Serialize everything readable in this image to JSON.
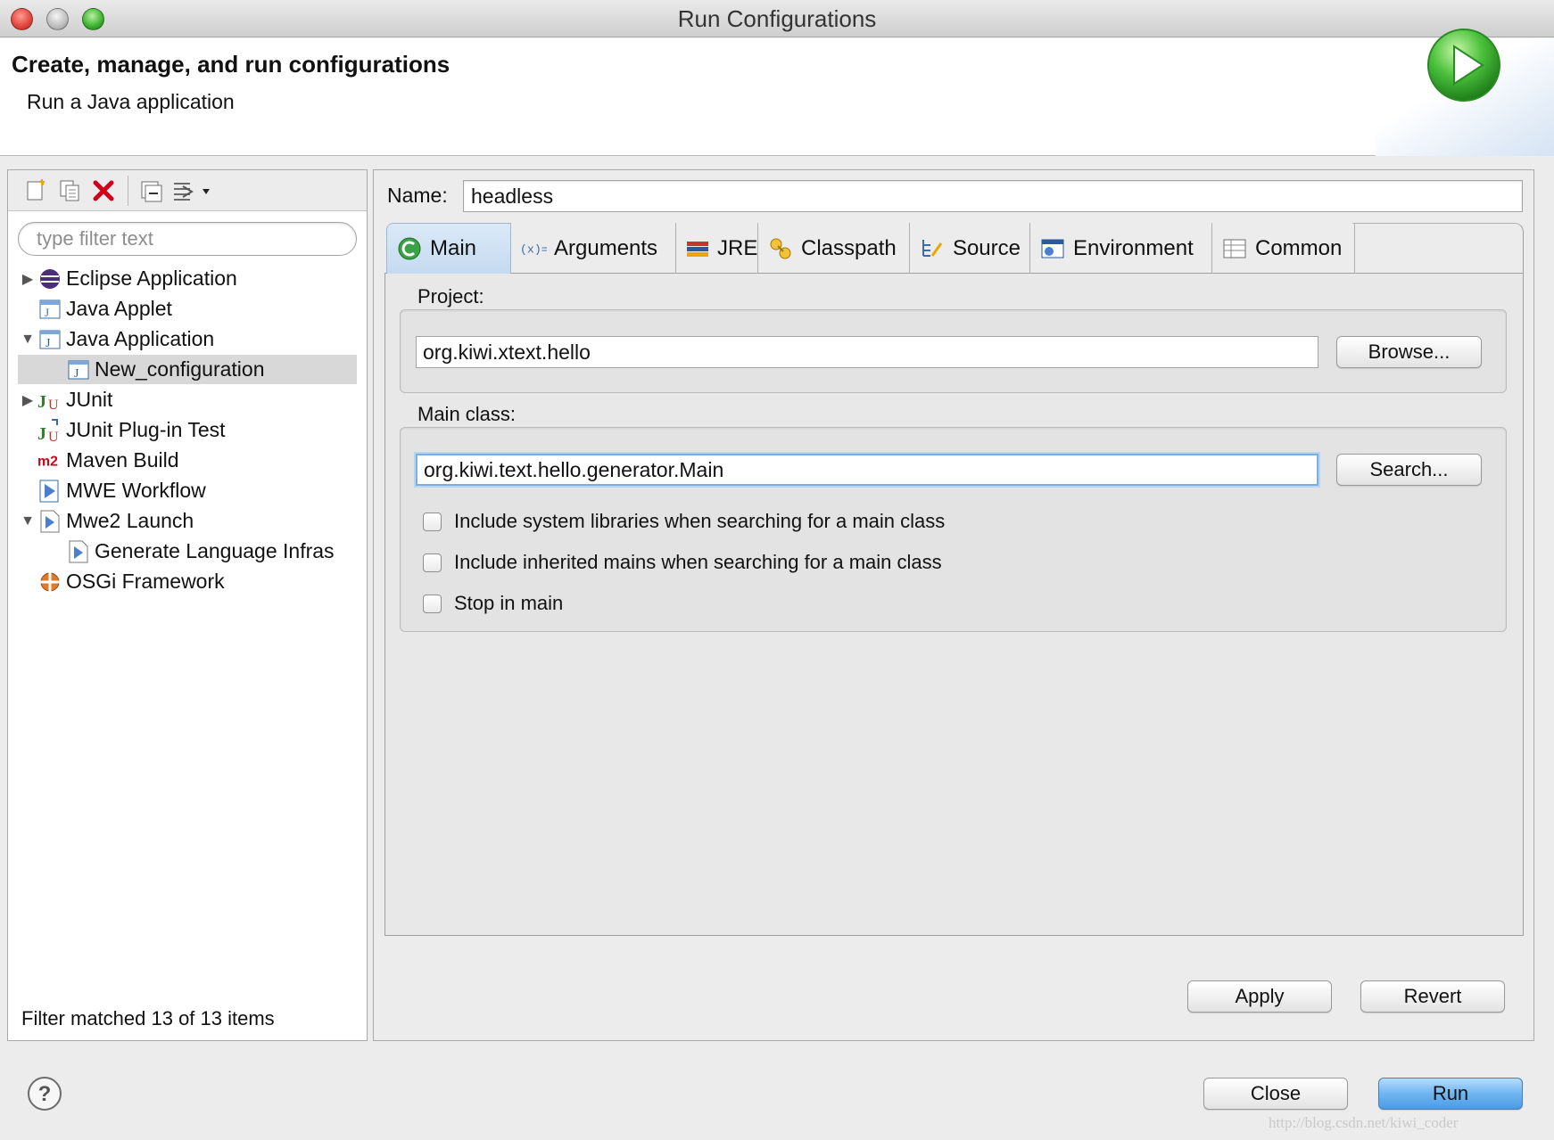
{
  "window": {
    "title": "Run Configurations"
  },
  "header": {
    "title": "Create, manage, and run configurations",
    "subtitle": "Run a Java application"
  },
  "sidebar": {
    "filter_placeholder": "type filter text",
    "tree": [
      {
        "label": "Eclipse Application",
        "icon": "eclipse-icon",
        "expandable": true,
        "expanded": false,
        "level": 0
      },
      {
        "label": "Java Applet",
        "icon": "java-applet-icon",
        "expandable": false,
        "level": 0
      },
      {
        "label": "Java Application",
        "icon": "java-application-icon",
        "expandable": true,
        "expanded": true,
        "level": 0
      },
      {
        "label": "New_configuration",
        "icon": "java-application-icon",
        "expandable": false,
        "level": 1,
        "selected": true
      },
      {
        "label": "JUnit",
        "icon": "junit-icon",
        "expandable": true,
        "expanded": false,
        "level": 0
      },
      {
        "label": "JUnit Plug-in Test",
        "icon": "junit-plugin-icon",
        "expandable": false,
        "level": 0
      },
      {
        "label": "Maven Build",
        "icon": "maven-icon",
        "expandable": false,
        "level": 0
      },
      {
        "label": "MWE Workflow",
        "icon": "mwe-workflow-icon",
        "expandable": false,
        "level": 0
      },
      {
        "label": "Mwe2 Launch",
        "icon": "mwe2-launch-icon",
        "expandable": true,
        "expanded": true,
        "level": 0
      },
      {
        "label": "Generate Language Infras",
        "icon": "mwe2-launch-icon",
        "expandable": false,
        "level": 1
      },
      {
        "label": "OSGi Framework",
        "icon": "osgi-icon",
        "expandable": false,
        "level": 0
      }
    ],
    "status": "Filter matched 13 of 13 items"
  },
  "config": {
    "name_label": "Name:",
    "name_value": "headless",
    "tabs": [
      {
        "label": "Main",
        "icon": "main-tab-icon",
        "active": true
      },
      {
        "label": "Arguments",
        "icon": "arguments-icon"
      },
      {
        "label": "JRE",
        "icon": "jre-icon"
      },
      {
        "label": "Classpath",
        "icon": "classpath-icon"
      },
      {
        "label": "Source",
        "icon": "source-icon"
      },
      {
        "label": "Environment",
        "icon": "environment-icon"
      },
      {
        "label": "Common",
        "icon": "common-icon"
      }
    ],
    "main": {
      "project_label": "Project:",
      "project_value": "org.kiwi.xtext.hello",
      "browse_label": "Browse...",
      "mainclass_label": "Main class:",
      "mainclass_value": "org.kiwi.text.hello.generator.Main",
      "search_label": "Search...",
      "options": [
        {
          "label": "Include system libraries when searching for a main class",
          "checked": false
        },
        {
          "label": "Include inherited mains when searching for a main class",
          "checked": false
        },
        {
          "label": "Stop in main",
          "checked": false
        }
      ]
    },
    "apply_label": "Apply",
    "revert_label": "Revert"
  },
  "footer": {
    "close_label": "Close",
    "run_label": "Run",
    "watermark": "http://blog.csdn.net/kiwi_coder"
  },
  "colors": {
    "run_button": "#6fb6f1",
    "selection": "#d8d8d8",
    "delete_icon": "#d0021b",
    "run_icon": "#3bb33a"
  }
}
